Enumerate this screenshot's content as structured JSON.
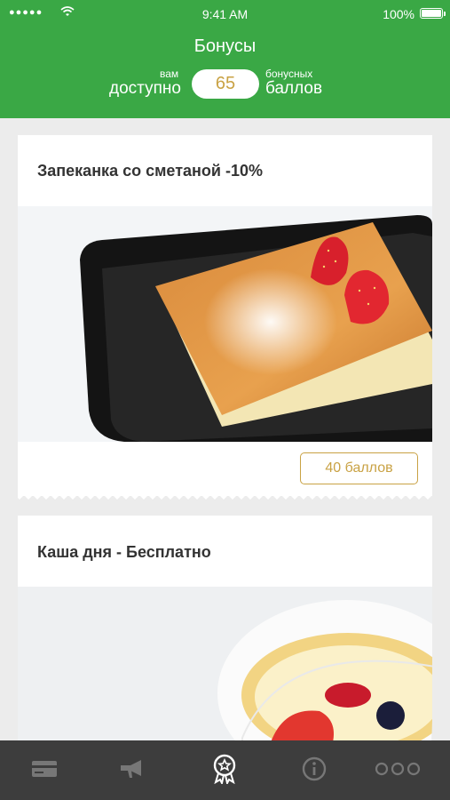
{
  "status_bar": {
    "signal": "●●●●●",
    "time": "9:41 AM",
    "battery": "100%"
  },
  "header": {
    "title": "Бонусы",
    "available_small": "вам",
    "available_big": "доступно",
    "points": "65",
    "points_small": "бонусных",
    "points_big": "баллов"
  },
  "offers": [
    {
      "title": "Запеканка со сметаной  -10%",
      "price": "40 баллов"
    },
    {
      "title": "Каша дня - Бесплатно"
    }
  ],
  "tabbar": {
    "items": [
      {
        "icon": "card-icon",
        "active": false
      },
      {
        "icon": "megaphone-icon",
        "active": false
      },
      {
        "icon": "award-icon",
        "active": true
      },
      {
        "icon": "info-icon",
        "active": false
      },
      {
        "icon": "more-icon",
        "active": false
      }
    ]
  },
  "colors": {
    "brand_green": "#3aa845",
    "accent_gold": "#c9a244",
    "tabbar_bg": "#3d3d3d"
  }
}
